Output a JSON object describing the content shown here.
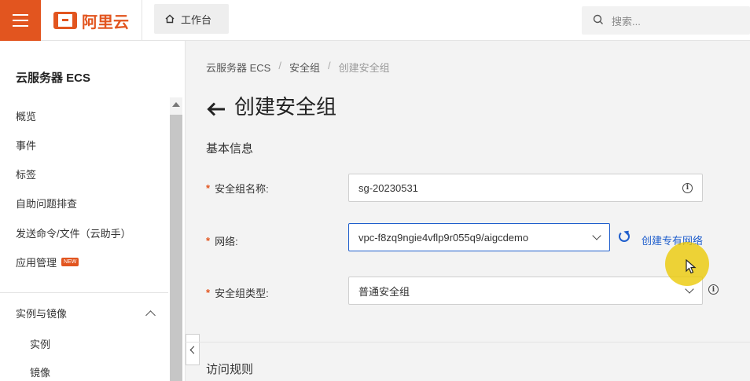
{
  "header": {
    "logo_text": "阿里云",
    "workbench_label": "工作台",
    "search_placeholder": "搜索..."
  },
  "sidebar": {
    "title": "云服务器 ECS",
    "items": [
      "概览",
      "事件",
      "标签",
      "自助问题排查",
      "发送命令/文件（云助手）",
      "应用管理"
    ],
    "new_badge": "NEW",
    "group": {
      "label": "实例与镜像",
      "sub_items": [
        "实例",
        "镜像"
      ]
    }
  },
  "breadcrumb": [
    "云服务器 ECS",
    "安全组",
    "创建安全组"
  ],
  "breadcrumb_sep": "/",
  "page": {
    "title": "创建安全组",
    "section_basic": "基本信息",
    "section_rules": "访问规则"
  },
  "form": {
    "required_mark": "*",
    "name_label": "安全组名称:",
    "name_value": "sg-20230531",
    "network_label": "网络:",
    "network_value": "vpc-f8zq9ngie4vflp9r055q9/aigcdemo",
    "create_vpc_link": "创建专有网络",
    "type_label": "安全组类型:",
    "type_value": "普通安全组",
    "info_glyph": "i"
  },
  "colors": {
    "brand": "#e2551f",
    "link": "#1f5ecc",
    "cursor_highlight": "#ebc800"
  }
}
